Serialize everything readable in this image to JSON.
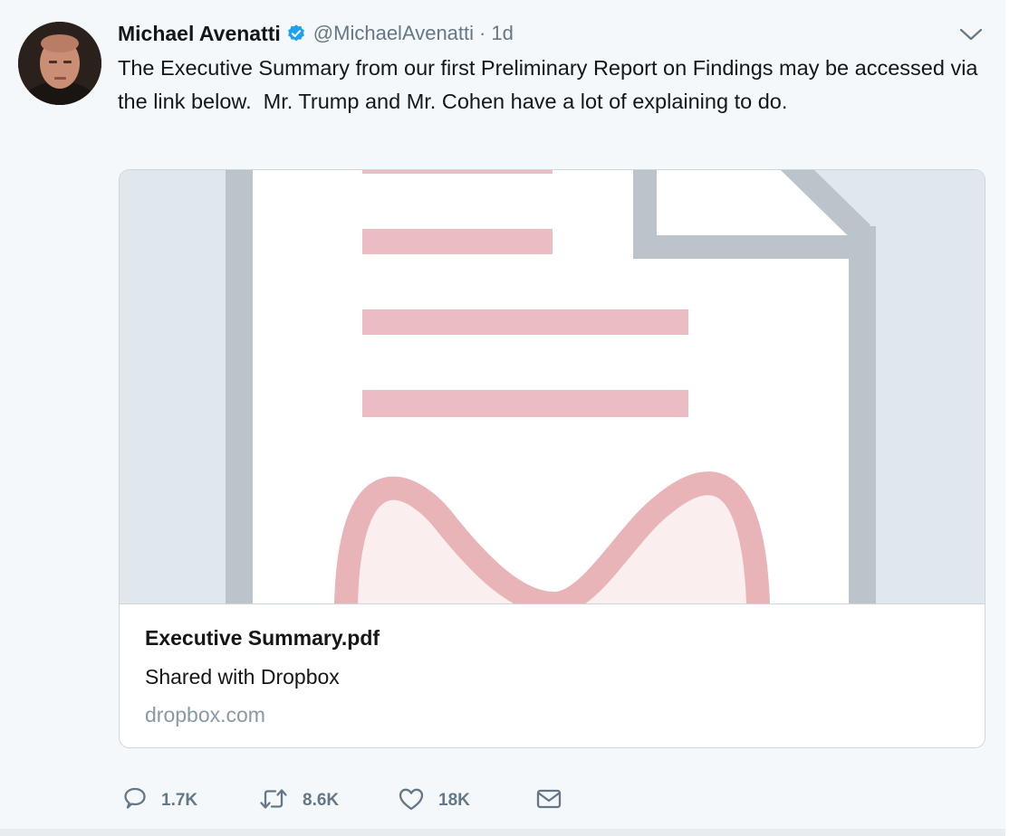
{
  "tweet": {
    "author_name": "Michael Avenatti",
    "handle": "@MichaelAvenatti",
    "separator": "·",
    "time": "1d",
    "text": "The Executive Summary from our first Preliminary Report on Findings may be accessed via the link below.  Mr. Trump and Mr. Cohen have a lot of explaining to do."
  },
  "card": {
    "title": "Executive Summary.pdf",
    "description": "Shared with Dropbox",
    "domain": "dropbox.com"
  },
  "actions": {
    "replies": "1.7K",
    "retweets": "8.6K",
    "likes": "18K"
  },
  "icons": {
    "verified": "verified-badge-icon",
    "caret": "chevron-down-icon",
    "reply": "reply-icon",
    "retweet": "retweet-icon",
    "like": "heart-icon",
    "dm": "envelope-icon"
  },
  "colors": {
    "verified_blue": "#1da1f2",
    "secondary_text": "#657786",
    "domain_text": "#8899a6",
    "document_pink": "#e8b4b8"
  }
}
